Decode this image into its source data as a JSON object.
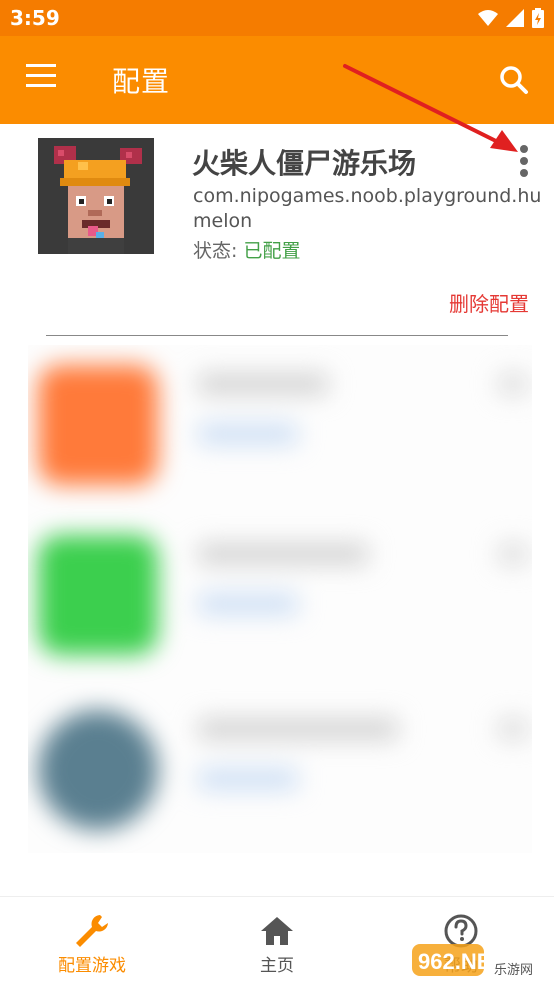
{
  "status_bar": {
    "time": "3:59"
  },
  "app_bar": {
    "title": "配置"
  },
  "card": {
    "title": "火柴人僵尸游乐场",
    "package": "com.nipogames.noob.playground.humelon",
    "status_label": "状态:",
    "status_value": "已配置",
    "delete_label": "删除配置"
  },
  "bottom_nav": {
    "items": [
      {
        "label": "配置游戏"
      },
      {
        "label": "主页"
      },
      {
        "label": "帮助"
      }
    ]
  },
  "watermark": {
    "text": "962.NET",
    "subtext": "乐游网"
  },
  "colors": {
    "app_bar": "#fb8c00",
    "status_bar": "#f57c00",
    "accent": "#fb8c00",
    "status_ok": "#43a047",
    "danger": "#e53935",
    "annotation_arrow": "#e02020"
  }
}
